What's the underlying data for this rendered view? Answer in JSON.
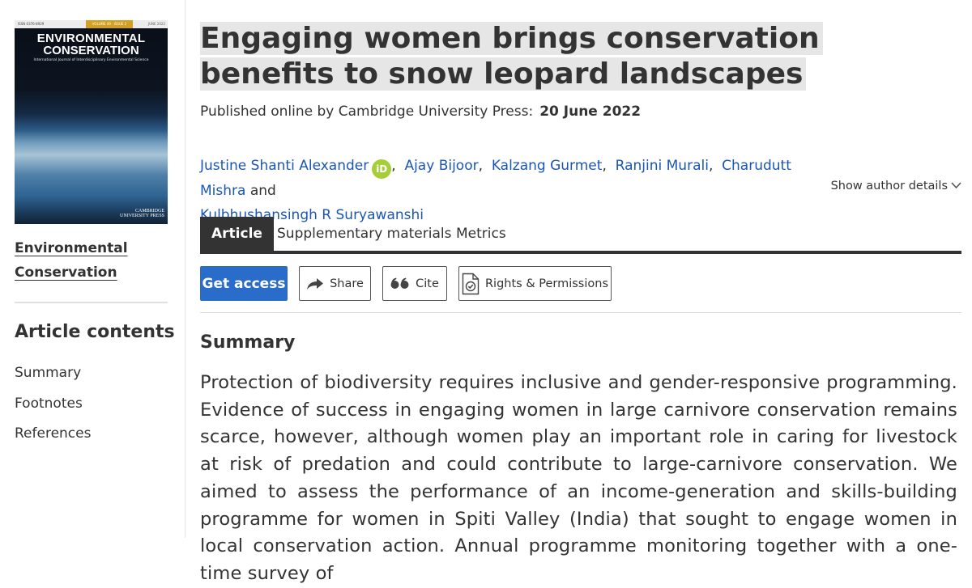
{
  "sidebar": {
    "cover": {
      "issn": "ISSN 0376-8929",
      "volume": "VOLUME 49 · ISSUE 2",
      "date": "JUNE 2022",
      "title_line1": "ENVIRONMENTAL",
      "title_line2": "CONSERVATION",
      "subtitle": "International Journal of Interdisciplinary Environmental Science",
      "publisher": "CAMBRIDGE\nUNIVERSITY PRESS"
    },
    "journal_name": "Environmental Conservation",
    "contents_title": "Article contents",
    "toc": [
      "Summary",
      "Footnotes",
      "References"
    ]
  },
  "article": {
    "title": "Engaging women brings conservation benefits to snow leopard landscapes",
    "published_label": "Published online by Cambridge University Press:",
    "published_date": "20 June 2022",
    "authors": [
      "Justine Shanti Alexander",
      "Ajay Bijoor",
      "Kalzang Gurmet",
      "Ranjini Murali",
      "Charudutt Mishra",
      "Kulbhushansingh R Suryawanshi"
    ],
    "orcid_label": "iD",
    "and": "and",
    "show_author_details": "Show author details"
  },
  "tabs": [
    "Article",
    "Supplementary materials",
    "Metrics"
  ],
  "actions": {
    "get_access": "Get access",
    "share": "Share",
    "cite": "Cite",
    "rights": "Rights & Permissions"
  },
  "summary": {
    "heading": "Summary",
    "text": "Protection of biodiversity requires inclusive and gender-responsive programming. Evidence of success in engaging women in large carnivore conservation remains scarce, however, although women play an important role in caring for livestock at risk of predation and could contribute to large-carnivore conservation. We aimed to assess the performance of an income-generation and skills-building programme for women in Spiti Valley (India) that sought to engage women in local conservation action. Annual programme monitoring together with a one-time survey of"
  },
  "colors": {
    "link": "#1a56b5",
    "primary_button": "#2a6cc9",
    "orcid": "#a6ce39",
    "tab_active": "#333333",
    "title_highlight": "#e6e6e6"
  }
}
